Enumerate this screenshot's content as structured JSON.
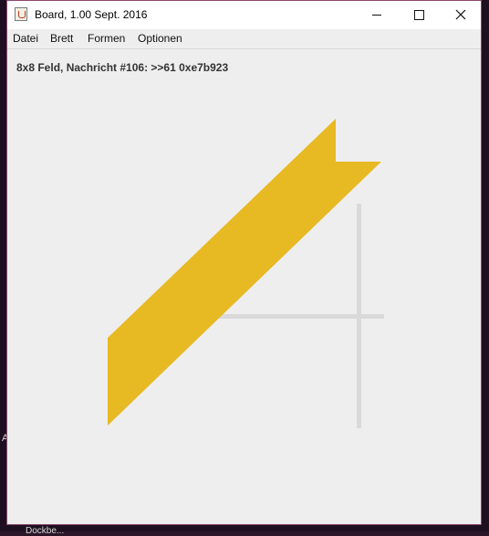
{
  "window": {
    "title": "Board, 1.00 Sept. 2016",
    "controls": {
      "minimize": "minimize-icon",
      "maximize": "maximize-icon",
      "close": "close-icon"
    }
  },
  "menu": {
    "items": [
      {
        "label": "Datei"
      },
      {
        "label": "Brett"
      },
      {
        "label": "Formen"
      },
      {
        "label": "Optionen"
      }
    ]
  },
  "status": {
    "message": "8x8 Feld, Nachricht #106: >>61 0xe7b923"
  },
  "board": {
    "shape_color": "#e7b923",
    "cross_color": "#d9d9d9"
  },
  "desktop": {
    "label_a": "A",
    "label_b": "Dockbe..."
  }
}
